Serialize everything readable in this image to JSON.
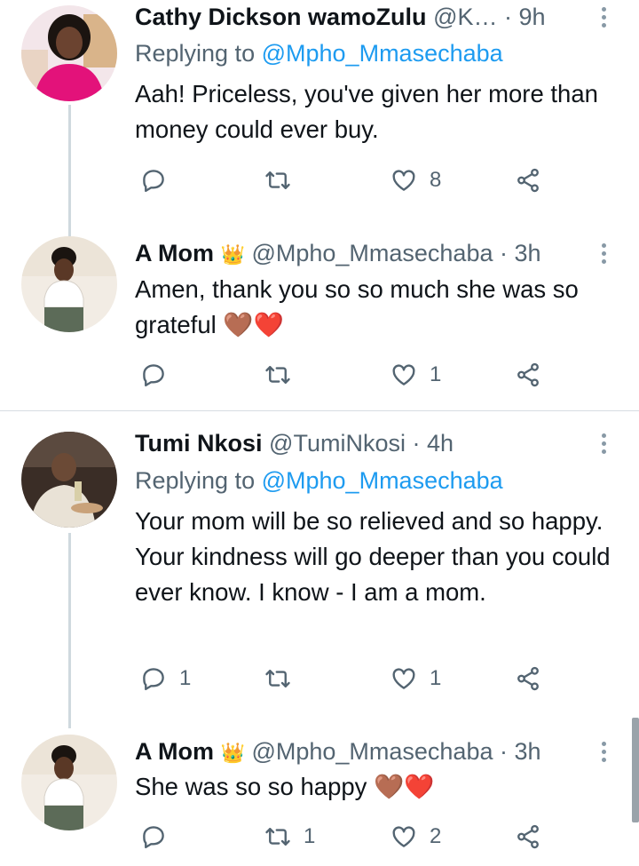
{
  "tweets": [
    {
      "name": "Cathy Dickson wamoZulu",
      "handle": "@K…",
      "dot": "·",
      "time": "9h",
      "replying_prefix": "Replying to",
      "replying_to": "@Mpho_Mmasechaba",
      "text": "Aah! Priceless, you've given her more than money could ever buy.",
      "reply_count": "",
      "retweet_count": "",
      "like_count": "8"
    },
    {
      "name": "A Mom",
      "badge": "👑",
      "handle": "@Mpho_Mmasechaba",
      "dot": "·",
      "time": "3h",
      "text": "Amen, thank you so so much she was so grateful 🤎❤️",
      "reply_count": "",
      "retweet_count": "",
      "like_count": "1"
    },
    {
      "name": "Tumi Nkosi",
      "handle": "@TumiNkosi",
      "dot": "·",
      "time": "4h",
      "replying_prefix": "Replying to",
      "replying_to": "@Mpho_Mmasechaba",
      "text": "Your mom will be so relieved and so happy. Your kindness will go deeper than you could ever know. I know - I am a mom.",
      "reply_count": "1",
      "retweet_count": "",
      "like_count": "1"
    },
    {
      "name": "A Mom",
      "badge": "👑",
      "handle": "@Mpho_Mmasechaba",
      "dot": "·",
      "time": "3h",
      "text": "She was so so happy 🤎❤️",
      "reply_count": "",
      "retweet_count": "1",
      "like_count": "2"
    }
  ],
  "colors": {
    "text": "#0f1419",
    "secondary": "#536471",
    "link": "#1d9bf0",
    "heart": "#e0245e",
    "thread_line": "#cfd9de"
  },
  "icons": [
    "reply-icon",
    "retweet-icon",
    "like-icon",
    "share-icon",
    "more-options-icon",
    "crown-icon"
  ]
}
